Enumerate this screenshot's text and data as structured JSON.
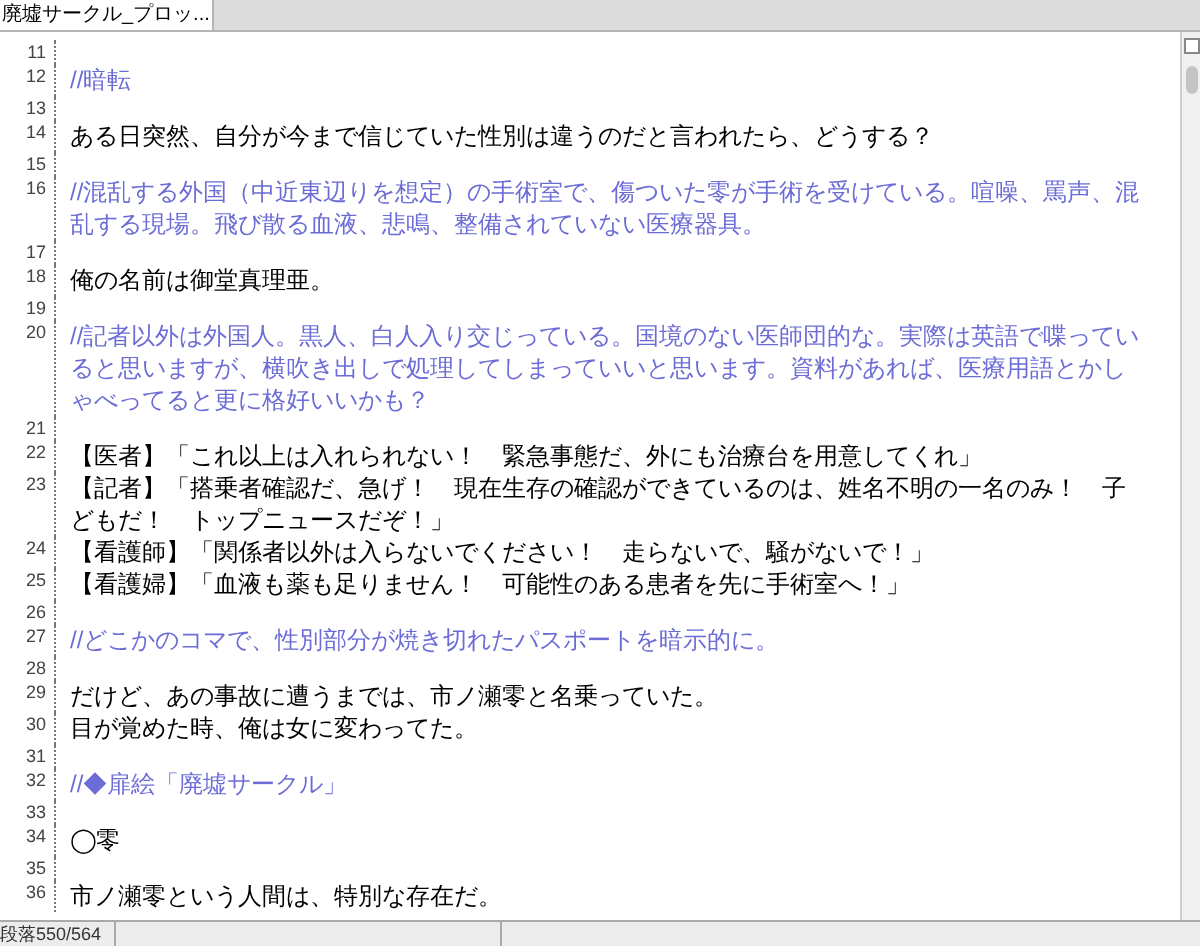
{
  "tabs": [
    {
      "label": "廃墟サークル_プロッ...",
      "selected": true
    }
  ],
  "lines": [
    {
      "number": "11",
      "kind": "blank"
    },
    {
      "number": "12",
      "kind": "comment",
      "text": "//暗転"
    },
    {
      "number": "13",
      "kind": "blank"
    },
    {
      "number": "14",
      "kind": "text",
      "text": "ある日突然、自分が今まで信じていた性別は違うのだと言われたら、どうする？"
    },
    {
      "number": "15",
      "kind": "blank"
    },
    {
      "number": "16",
      "kind": "comment",
      "text": "//混乱する外国（中近東辺りを想定）の手術室で、傷ついた零が手術を受けている。喧噪、罵声、混乱する現場。飛び散る血液、悲鳴、整備されていない医療器具。"
    },
    {
      "number": "17",
      "kind": "blank"
    },
    {
      "number": "18",
      "kind": "text",
      "text": "俺の名前は御堂真理亜。"
    },
    {
      "number": "19",
      "kind": "blank"
    },
    {
      "number": "20",
      "kind": "comment",
      "text": "//記者以外は外国人。黒人、白人入り交じっている。国境のない医師団的な。実際は英語で喋っていると思いますが、横吹き出しで処理してしまっていいと思います。資料があれば、医療用語とかしゃべってると更に格好いいかも？"
    },
    {
      "number": "21",
      "kind": "blank"
    },
    {
      "number": "22",
      "kind": "text",
      "text": "【医者】「これ以上は入れられない！　緊急事態だ、外にも治療台を用意してくれ」"
    },
    {
      "number": "23",
      "kind": "text",
      "text": "【記者】「搭乗者確認だ、急げ！　現在生存の確認ができているのは、姓名不明の一名のみ！　子どもだ！　トップニュースだぞ！」"
    },
    {
      "number": "24",
      "kind": "text",
      "text": "【看護師】「関係者以外は入らないでください！　走らないで、騒がないで！」"
    },
    {
      "number": "25",
      "kind": "text",
      "text": "【看護婦】「血液も薬も足りません！　可能性のある患者を先に手術室へ！」"
    },
    {
      "number": "26",
      "kind": "blank"
    },
    {
      "number": "27",
      "kind": "comment",
      "text": "//どこかのコマで、性別部分が焼き切れたパスポートを暗示的に。"
    },
    {
      "number": "28",
      "kind": "blank"
    },
    {
      "number": "29",
      "kind": "text",
      "text": "だけど、あの事故に遭うまでは、市ノ瀬零と名乗っていた。"
    },
    {
      "number": "30",
      "kind": "text",
      "text": "目が覚めた時、俺は女に変わってた。"
    },
    {
      "number": "31",
      "kind": "blank"
    },
    {
      "number": "32",
      "kind": "comment",
      "text": "//◆扉絵「廃墟サークル」"
    },
    {
      "number": "33",
      "kind": "blank"
    },
    {
      "number": "34",
      "kind": "text",
      "text": "◯零"
    },
    {
      "number": "35",
      "kind": "blank"
    },
    {
      "number": "36",
      "kind": "text",
      "text": "市ノ瀬零という人間は、特別な存在だ。"
    }
  ],
  "status_bar": "段落550/564"
}
